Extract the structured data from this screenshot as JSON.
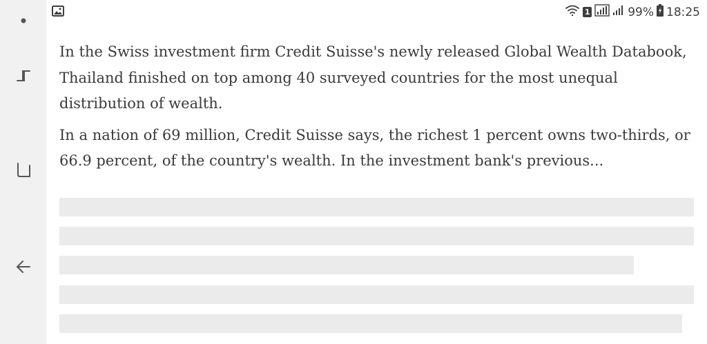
{
  "status_bar": {
    "left_icon": "image-notification-icon",
    "sim_badge": "1",
    "battery_percent": "99%",
    "time": "18:25"
  },
  "nav_bar": {
    "items": [
      "dot-icon",
      "recent-apps-icon",
      "home-icon",
      "back-icon"
    ]
  },
  "article": {
    "paragraphs": [
      "In the Swiss investment firm Credit Suisse's newly released Global Wealth Databook, Thailand finished on top among 40 surveyed countries for the most unequal distribution of wealth.",
      "In a nation of 69 million, Credit Suisse says, the richest 1 percent owns two-thirds, or 66.9 percent, of the country's wealth. In the investment bank's previous..."
    ]
  },
  "colors": {
    "text": "#3a3a3a",
    "placeholder": "#ebebeb",
    "navbar": "#f1f1f1"
  }
}
